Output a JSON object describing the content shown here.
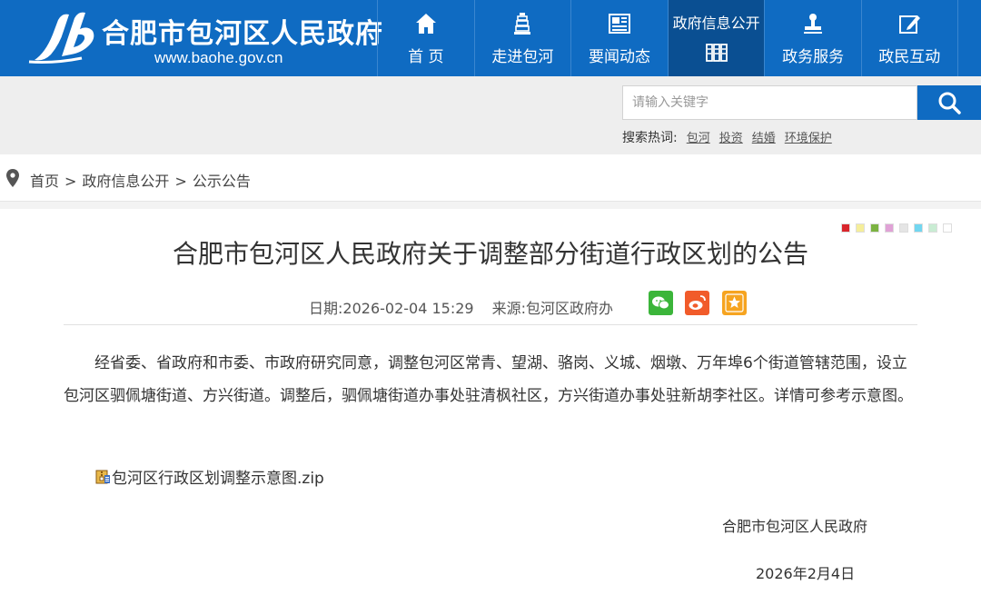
{
  "header": {
    "site_title": "合肥市包河区人民政府",
    "site_url": "www.baohe.gov.cn",
    "brand_color": "#0f6bc2"
  },
  "nav": {
    "items": [
      {
        "label": "首 页",
        "icon": "home-icon"
      },
      {
        "label": "走进包河",
        "icon": "tower-icon"
      },
      {
        "label": "要闻动态",
        "icon": "newspaper-icon"
      },
      {
        "label": "政府信息公开",
        "icon": "documents-icon",
        "active": true
      },
      {
        "label": "政务服务",
        "icon": "stamp-icon"
      },
      {
        "label": "政民互动",
        "icon": "edit-icon"
      }
    ]
  },
  "search": {
    "placeholder": "请输入关键字",
    "hot_label": "搜索热词:",
    "hot_words": [
      "包河",
      "投资",
      "结婚",
      "环境保护"
    ]
  },
  "breadcrumb": {
    "items": [
      "首页",
      "政府信息公开",
      "公示公告"
    ],
    "separator": ">"
  },
  "theme_swatches": [
    "#d9262c",
    "#f5ee9a",
    "#7cb342",
    "#e0a2d6",
    "#e5e5e5",
    "#72d6f0",
    "#c9ecd3",
    "#ffffff"
  ],
  "article": {
    "title": "合肥市包河区人民政府关于调整部分街道行政区划的公告",
    "date_label": "日期:",
    "date": "2026-02-04 15:29",
    "source_label": "来源:",
    "source": "包河区政府办",
    "share": [
      "wechat-icon",
      "weibo-icon",
      "star-icon"
    ],
    "body": "经省委、省政府和市委、市政府研究同意，调整包河区常青、望湖、骆岗、义城、烟墩、万年埠6个街道管辖范围，设立包河区驷佩塘街道、方兴街道。调整后，驷佩塘街道办事处驻清枫社区，方兴街道办事处驻新胡李社区。详情可参考示意图。",
    "attachment": "包河区行政区划调整示意图.zip",
    "signature_org": "合肥市包河区人民政府",
    "signature_date": "2026年2月4日"
  }
}
